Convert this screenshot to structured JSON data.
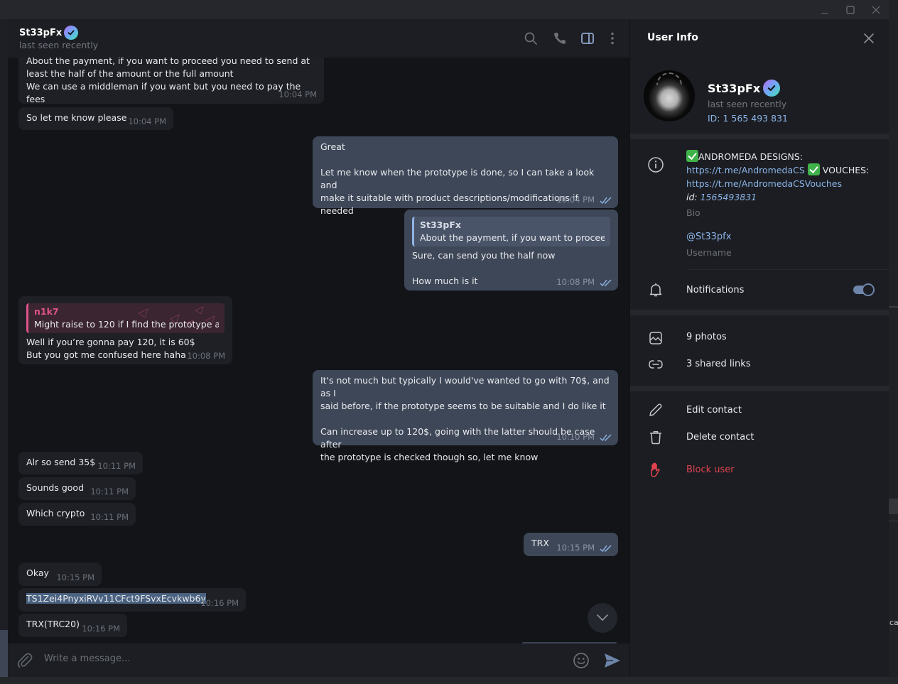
{
  "window": {
    "controls": {
      "minimize": "—",
      "maximize": "☐",
      "close": "✕"
    }
  },
  "chat": {
    "header": {
      "name": "St33pFx",
      "verified": true,
      "status": "last seen recently",
      "icons": [
        "search-icon",
        "phone-icon",
        "sidebar-toggle-icon",
        "more-icon"
      ]
    },
    "messages": [
      {
        "dir": "in",
        "lines": [
          "About the payment, if you want to proceed you need to send at",
          "least the half of the amount or the full amount",
          "We can use a middleman if you want but you need to pay the fees"
        ],
        "time": "10:04 PM"
      },
      {
        "dir": "in",
        "text": "So let me know please",
        "time": "10:04 PM"
      },
      {
        "dir": "out",
        "lines": [
          "Great",
          "",
          "Let me know when the prototype is done, so I can take a look and",
          "make it suitable with product descriptions/modifications if needed"
        ],
        "time": "10:04 PM",
        "read": true
      },
      {
        "dir": "out",
        "reply": {
          "name": "St33pFx",
          "text": "About the payment, if you want to procee..."
        },
        "lines": [
          "Sure, can send you the half now",
          "",
          "How much is it"
        ],
        "time": "10:08 PM",
        "read": true
      },
      {
        "dir": "in",
        "reply": {
          "name": "n1k7",
          "text": "Might raise to 120 if I find the prototype a..."
        },
        "lines": [
          "Well if you’re gonna pay 120, it is 60$",
          "But you got me confused here haha"
        ],
        "time": "10:08 PM"
      },
      {
        "dir": "out",
        "lines": [
          "It's not much but typically I would've wanted to go with 70$, and as I",
          "said before, if the prototype seems to be suitable and I do like it",
          "",
          "Can increase up to 120$, going with the latter should be case after",
          "the prototype is checked though so, let me know"
        ],
        "time": "10:10 PM",
        "read": true
      },
      {
        "dir": "in",
        "text": "Alr so send 35$",
        "time": "10:11 PM"
      },
      {
        "dir": "in",
        "text": "Sounds good",
        "time": "10:11 PM"
      },
      {
        "dir": "in",
        "text": "Which crypto",
        "time": "10:11 PM"
      },
      {
        "dir": "out",
        "text": "TRX",
        "time": "10:15 PM",
        "read": true
      },
      {
        "dir": "in",
        "text": "Okay",
        "time": "10:15 PM"
      },
      {
        "dir": "in",
        "text": "TS1Zei4PnyxiRVv11CFct9FSvxEcvkwb6y",
        "time": "10:16 PM",
        "selected": true
      },
      {
        "dir": "in",
        "text": "TRX(TRC20)",
        "time": "10:16 PM"
      }
    ],
    "composer": {
      "placeholder": "Write a message..."
    }
  },
  "user_info": {
    "title": "User Info",
    "name": "St33pFx",
    "status": "last seen recently",
    "id": "ID: 1 565 493 831",
    "bio": {
      "line1": "ANDROMEDA DESIGNS:",
      "link1": "https://t.me/AndromedaCS",
      "vouches": "VOUCHES:",
      "link2": "https://t.me/AndromedaCSVouches",
      "id_label": "id:",
      "id_value": "1565493831",
      "label": "Bio"
    },
    "username": {
      "value": "@St33pfx",
      "label": "Username"
    },
    "notifications": {
      "label": "Notifications",
      "enabled": true
    },
    "media": [
      {
        "label": "9 photos",
        "icon": "photo-icon"
      },
      {
        "label": "3 shared links",
        "icon": "link-icon"
      }
    ],
    "actions": {
      "edit": "Edit contact",
      "delete": "Delete contact",
      "block": "Block user"
    },
    "colors": {
      "accent": "#8bb4e8",
      "danger": "#e0434e",
      "out_bubble": "#3e4758",
      "in_bubble": "#1e2026",
      "reply_pink": "#e0528a"
    }
  },
  "background_window": {
    "partial_text": "ca"
  }
}
